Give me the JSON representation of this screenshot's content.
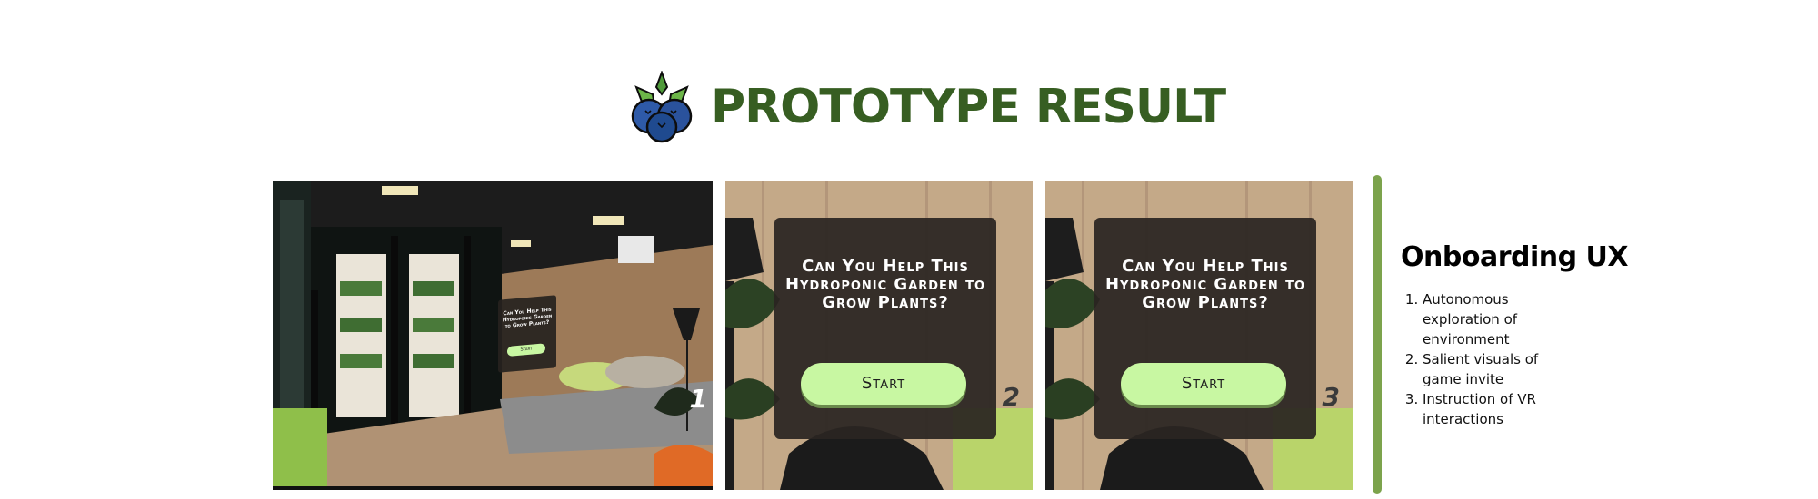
{
  "header": {
    "title": "PROTOTYPE RESULT",
    "logo_icon": "blueberry-icon"
  },
  "colors": {
    "title_green": "#375e22",
    "divider_green": "#7ca34c",
    "button_green": "#c8f7a2",
    "card_dark": "#2a2521",
    "blueberry": "#1f4a8f"
  },
  "panels": [
    {
      "number": "1",
      "invite_text": "Can You Help This Hydroponic Garden to Grow Plants?",
      "start_label": "Start"
    },
    {
      "number": "2",
      "invite_text": "Can You Help This Hydroponic Garden to Grow Plants?",
      "start_label": "Start"
    },
    {
      "number": "3",
      "invite_text": "Can You Help This Hydroponic Garden to Grow Plants?",
      "start_label": "Start"
    }
  ],
  "onboarding": {
    "title": "Onboarding UX",
    "items": [
      "Autonomous exploration of environment",
      "Salient visuals of game invite",
      "Instruction of VR interactions"
    ]
  }
}
